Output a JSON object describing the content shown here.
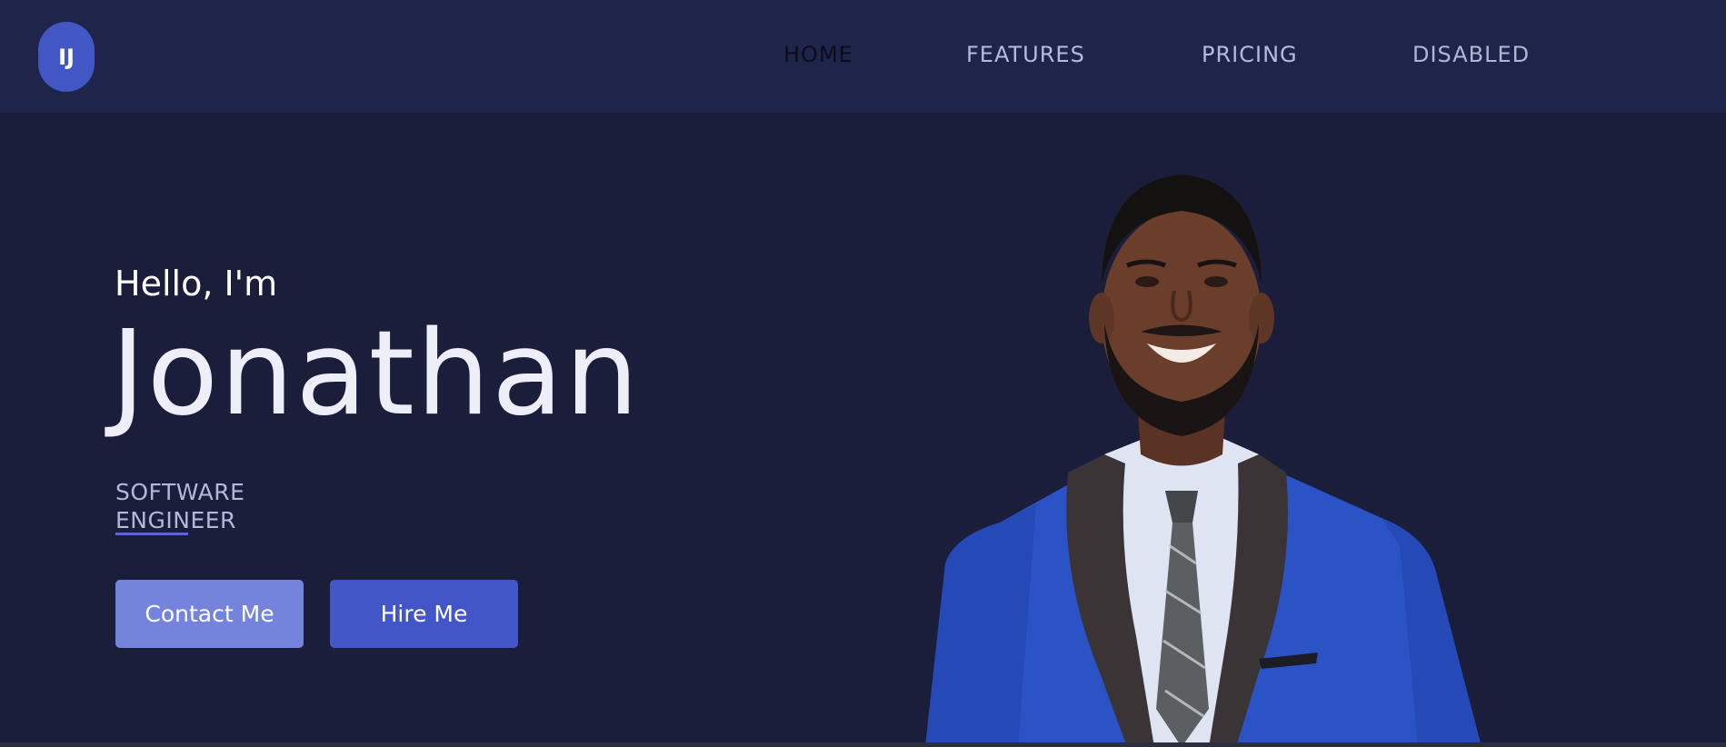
{
  "logo": {
    "initials": "IJ"
  },
  "nav": {
    "home": "HOME",
    "features": "FEATURES",
    "pricing": "PRICING",
    "disabled": "DISABLED"
  },
  "hero": {
    "greeting": "Hello, I'm",
    "name": "Jonathan",
    "role_line1": "SOFTWARE",
    "role_line2": "ENGINEER",
    "contact_label": "Contact Me",
    "hire_label": "Hire Me"
  },
  "colors": {
    "background": "#1b1e3b",
    "navbar": "#1f254a",
    "accent": "#4356c7",
    "accent_light": "#7483dc",
    "suit": "#2a52c4"
  },
  "icons": {
    "portrait": "person-photo"
  }
}
